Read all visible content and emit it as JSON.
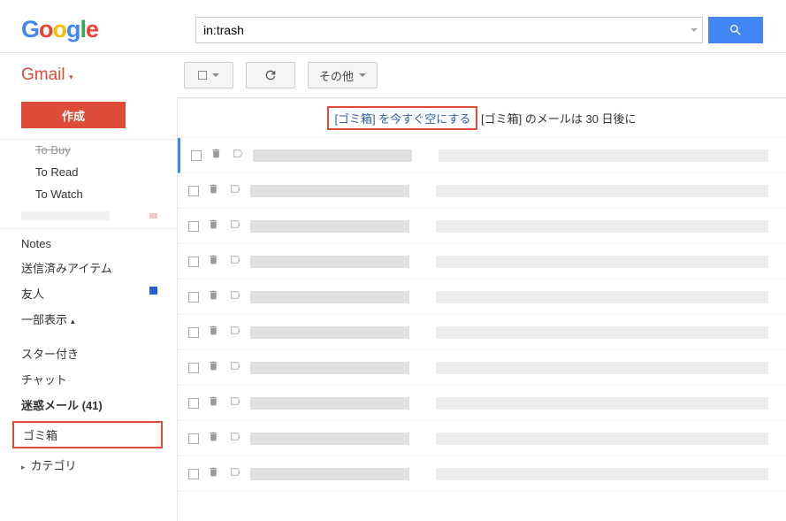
{
  "header": {
    "logo_chars": [
      "G",
      "o",
      "o",
      "g",
      "l",
      "e"
    ],
    "search_value": "in:trash"
  },
  "toolbar": {
    "gmail_label": "Gmail",
    "more_label": "その他"
  },
  "sidebar": {
    "compose": "作成",
    "items_indented": [
      "To Buy",
      "To Read",
      "To Watch"
    ],
    "notes": "Notes",
    "sent": "送信済みアイテム",
    "friends": "友人",
    "show_some": "一部表示",
    "starred": "スター付き",
    "chat": "チャット",
    "spam": "迷惑メール (41)",
    "trash": "ゴミ箱",
    "category": "カテゴリ"
  },
  "notice": {
    "empty_link": "[ゴミ箱] を今すぐ空にする",
    "rest": "[ゴミ箱] のメールは 30 日後に"
  },
  "mail_rows": 10
}
